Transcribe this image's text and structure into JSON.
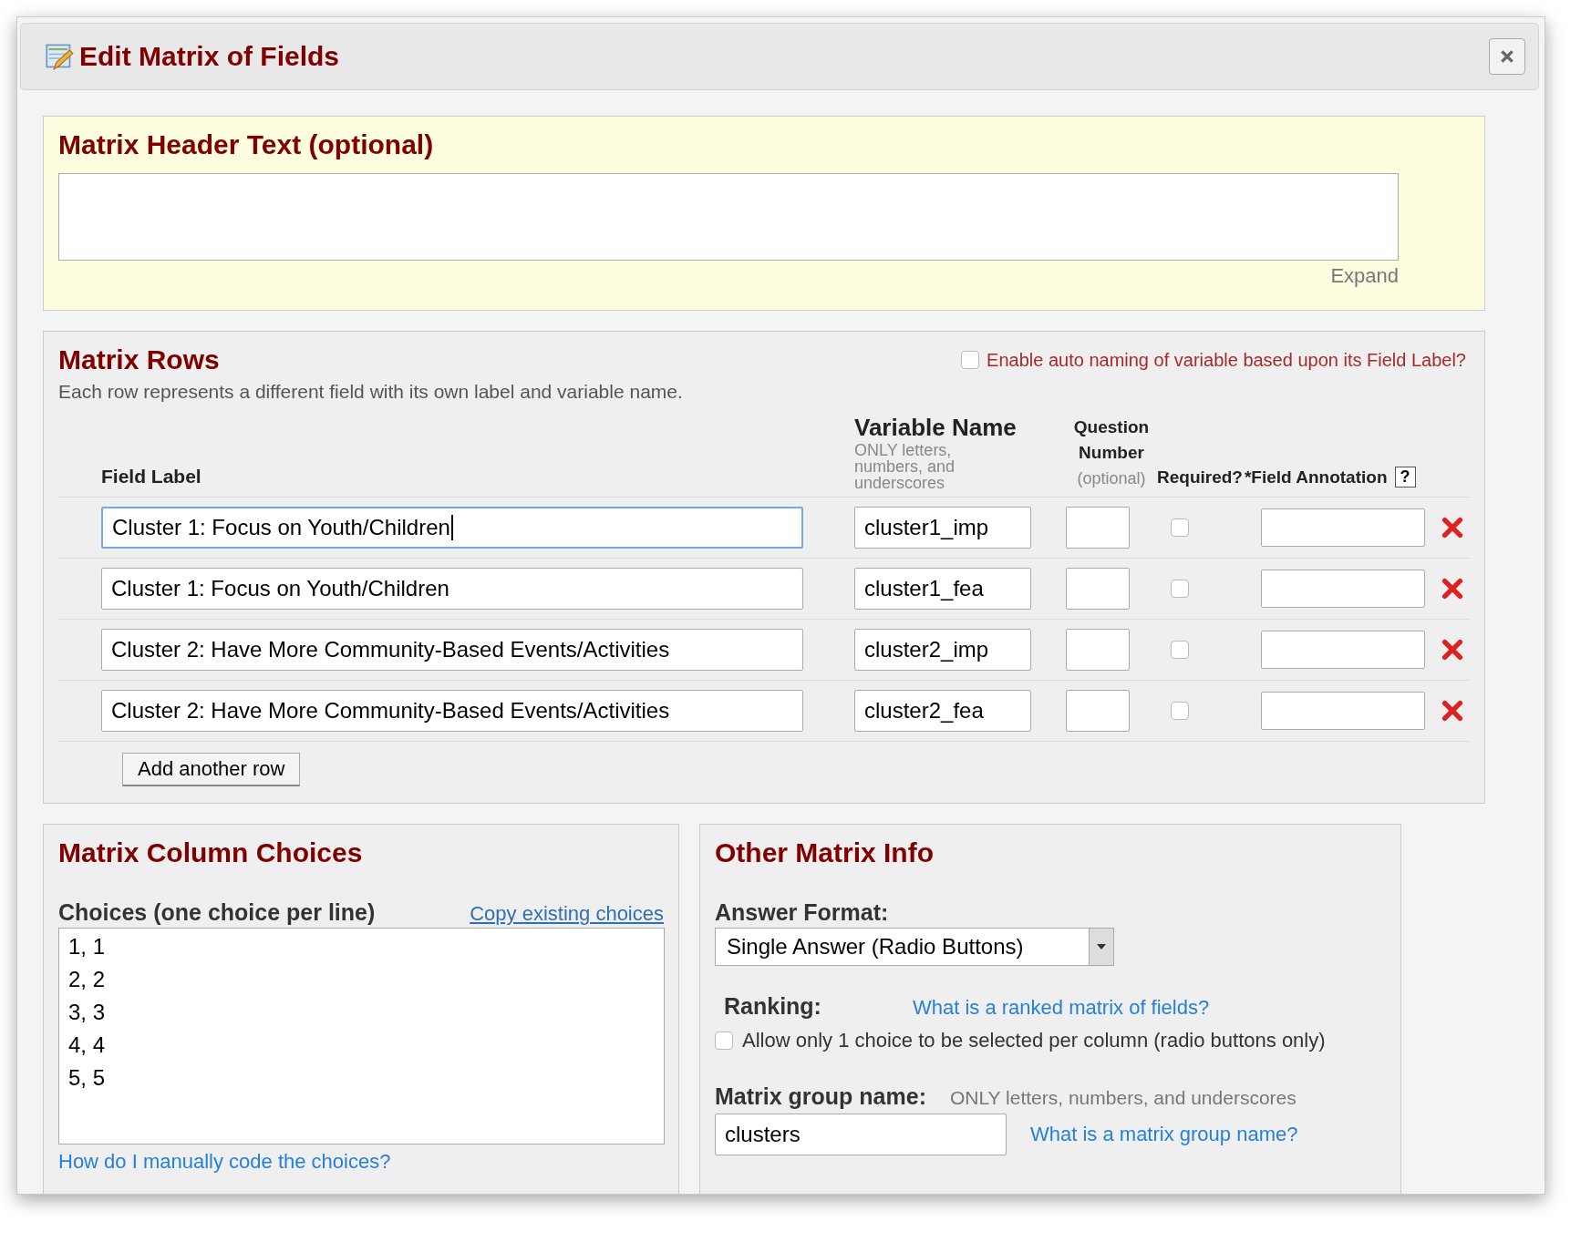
{
  "dialog": {
    "title": "Edit Matrix of Fields"
  },
  "header_section": {
    "title": "Matrix Header Text (optional)",
    "expand_link": "Expand"
  },
  "rows_section": {
    "title": "Matrix Rows",
    "description": "Each row represents a different field with its own label and variable name.",
    "auto_naming": {
      "label": "Enable auto naming of variable based upon its Field Label?",
      "checked": false
    },
    "columns": {
      "field_label": "Field Label",
      "variable_name": "Variable Name",
      "variable_name_hint": "ONLY letters, numbers, and underscores",
      "question_number": "Question Number",
      "question_number_hint": "(optional)",
      "required": "Required?",
      "field_annotation": "*Field Annotation",
      "help": "?"
    },
    "rows": [
      {
        "label": "Cluster 1: Focus on Youth/Children",
        "variable": "cluster1_imp",
        "required": false,
        "focused": true
      },
      {
        "label": "Cluster 1: Focus on Youth/Children",
        "variable": "cluster1_fea",
        "required": false,
        "focused": false
      },
      {
        "label": "Cluster 2: Have More Community-Based Events/Activities",
        "variable": "cluster2_imp",
        "required": false,
        "focused": false
      },
      {
        "label": "Cluster 2: Have More Community-Based Events/Activities",
        "variable": "cluster2_fea",
        "required": false,
        "focused": false
      }
    ],
    "add_button": "Add another row"
  },
  "choices_section": {
    "title": "Matrix Column Choices",
    "choices_label": "Choices (one choice per line)",
    "copy_link": "Copy existing choices",
    "choices": [
      "1, 1",
      "2, 2",
      "3, 3",
      "4, 4",
      "5, 5"
    ],
    "help_link": "How do I manually code the choices?"
  },
  "other_section": {
    "title": "Other Matrix Info",
    "answer_format_label": "Answer Format:",
    "answer_format": "Single Answer (Radio Buttons)",
    "ranking_label": "Ranking:",
    "ranking_link": "What is a ranked matrix of fields?",
    "ranking_option": {
      "label": "Allow only 1 choice to be selected per column (radio buttons only)",
      "checked": false
    },
    "group_name_label": "Matrix group name:",
    "group_name_hint": "ONLY letters, numbers, and underscores",
    "group_name": "clusters",
    "group_name_link": "What is a matrix group name?"
  }
}
